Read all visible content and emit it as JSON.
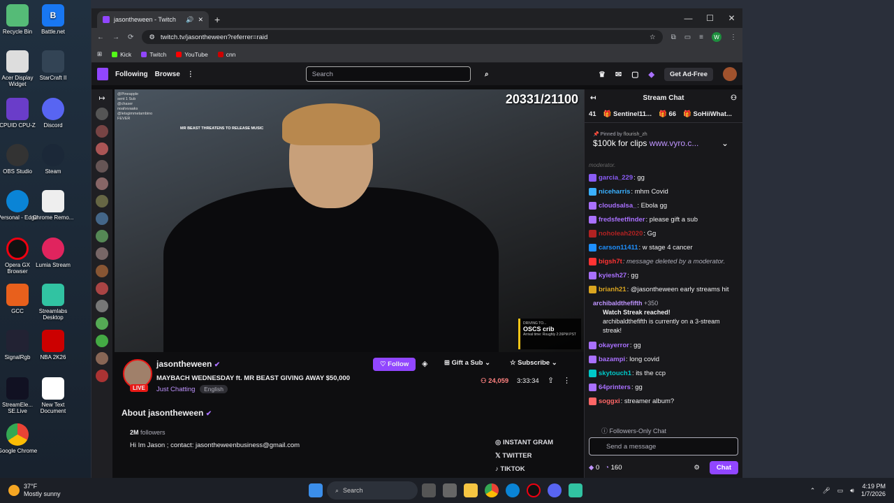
{
  "desktop": {
    "icons": [
      {
        "label": "Recycle Bin",
        "x": 0
      },
      {
        "label": "Battle.net"
      },
      {
        "label": "Acer Display Widget"
      },
      {
        "label": "StarCraft II"
      },
      {
        "label": "CPUID CPU-Z"
      },
      {
        "label": "Discord"
      },
      {
        "label": "OBS Studio"
      },
      {
        "label": "Steam"
      },
      {
        "label": "Personal - Edge"
      },
      {
        "label": "Chrome Remo..."
      },
      {
        "label": "Opera GX Browser"
      },
      {
        "label": "Lumia Stream"
      },
      {
        "label": "GCC"
      },
      {
        "label": "Streamlabs Desktop"
      },
      {
        "label": "SignalRgb"
      },
      {
        "label": "NBA 2K26"
      },
      {
        "label": "StreamEle... SE.Live"
      },
      {
        "label": "New Text Document"
      },
      {
        "label": "Google Chrome"
      }
    ]
  },
  "browser": {
    "tab_title": "jasontheween - Twitch",
    "url": "twitch.tv/jasontheween?referrer=raid",
    "bookmarks": [
      "Kick",
      "Twitch",
      "YouTube",
      "cnn"
    ],
    "profile_letter": "W"
  },
  "twitch_nav": {
    "following": "Following",
    "browse": "Browse",
    "search_placeholder": "Search",
    "get_ad_free": "Get Ad-Free"
  },
  "video": {
    "counter": "20331/21100",
    "overlay_lines": [
      "@Pineapple",
      "sent 1 Sub",
      "@chaser",
      "noahxvaaks",
      "@letsgimmetambino",
      "FEVER",
      "MR BEAST THREATENS TO RELEASE MUSIC"
    ],
    "eta_driving": "DRIVING TO...",
    "eta_dest": "OSCS crib",
    "eta_arrival": "Arrival time: Roughly 2:26PM PST"
  },
  "stream": {
    "channel": "jasontheween",
    "title": "MAYBACH WEDNESDAY ft. MR BEAST GIVING AWAY $50,000",
    "category": "Just Chatting",
    "tag": "English",
    "live": "LIVE",
    "viewers": "24,059",
    "uptime": "3:33:34",
    "follow": "Follow",
    "gift": "Gift a Sub",
    "subscribe": "Subscribe"
  },
  "about": {
    "title": "About jasontheween",
    "followers": "2M",
    "followers_label": "followers",
    "bio": "Hi Im Jason ; contact: jasontheweenbusiness@gmail.com",
    "socials": [
      "INSTANT GRAM",
      "TWITTER",
      "TIKTOK"
    ]
  },
  "chat": {
    "title": "Stream Chat",
    "gift_count": "41",
    "gifter1": "Sentinel11...",
    "gift_n": "66",
    "gifter2": "SoHiiWhat...",
    "pinned_by": "Pinned by",
    "pinned_user": "flourish_zh",
    "pinned_msg": "$100k for clips",
    "pinned_link": "www.vyro.c...",
    "faded": "moderator.",
    "messages": [
      {
        "user": "garcia_229",
        "text": ": gg",
        "color": "#8a5cf6"
      },
      {
        "user": "niceharris",
        "text": ": mhm Covid",
        "color": "#3ab0ff"
      },
      {
        "user": "cloudsalsa_",
        "text": ": Ebola gg",
        "color": "#a970ff"
      },
      {
        "user": "fredsfeetfinder",
        "text": ": please gift a sub",
        "color": "#a970ff"
      },
      {
        "user": "noholeah2020",
        "text": ": Gg",
        "color": "#b22222"
      },
      {
        "user": "carson11411",
        "text": ": w stage 4 cancer",
        "color": "#1e90ff"
      },
      {
        "user": "bigsh7t",
        "text": ": message deleted by a moderator.",
        "color": "#ff3333"
      },
      {
        "user": "kyiesh27",
        "text": ": gg",
        "color": "#a970ff"
      },
      {
        "user": "brianh21",
        "text": ": @jasontheween early streams hit",
        "color": "#daa520"
      }
    ],
    "streak": {
      "user": "archibaldthefifth",
      "points": "+350",
      "title": "Watch Streak reached!",
      "body": "archibaldthefifth is currently on a 3-stream streak!"
    },
    "messages2": [
      {
        "user": "okayerror",
        "text": ": gg",
        "color": "#a970ff"
      },
      {
        "user": "bazampi",
        "text": ": long covid",
        "color": "#a970ff"
      },
      {
        "user": "skytouch1",
        "text": ": its the ccp",
        "color": "#00c8c8"
      },
      {
        "user": "64printers",
        "text": ": gg",
        "color": "#a970ff"
      },
      {
        "user": "soggxi",
        "text": ": streamer album?",
        "color": "#ff6666"
      }
    ],
    "followers_only": "Followers-Only Chat",
    "input_placeholder": "Send a message",
    "bits": "0",
    "points": "160",
    "chat_button": "Chat"
  },
  "taskbar": {
    "weather_temp": "37°F",
    "weather_desc": "Mostly sunny",
    "search": "Search",
    "time": "4:19 PM",
    "date": "1/7/2026"
  }
}
